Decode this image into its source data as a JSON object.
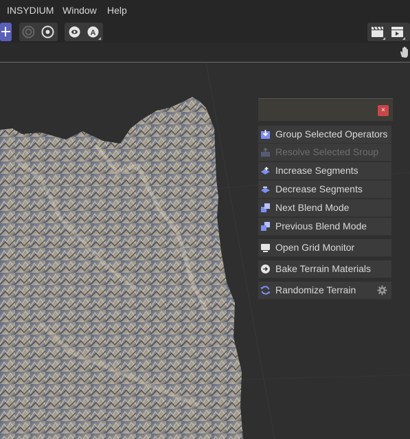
{
  "menu": {
    "items": [
      "INSYDIUM",
      "Window",
      "Help"
    ]
  },
  "panel": {
    "close_label": "×",
    "items": [
      {
        "label": "Group Selected Operators",
        "icon": "group-icon",
        "enabled": true
      },
      {
        "label": "Resolve Selected Sroup",
        "icon": "resolve-icon",
        "enabled": false
      },
      {
        "label": "Increase Segments",
        "icon": "increase-segments-icon",
        "enabled": true
      },
      {
        "label": "Decrease Segments",
        "icon": "decrease-segments-icon",
        "enabled": true
      },
      {
        "label": "Next Blend Mode",
        "icon": "next-blend-icon",
        "enabled": true
      },
      {
        "label": "Previous Blend Mode",
        "icon": "previous-blend-icon",
        "enabled": true
      },
      {
        "label": "Open Grid Monitor",
        "icon": "monitor-icon",
        "enabled": true
      },
      {
        "label": "Bake Terrain Materials",
        "icon": "bake-icon",
        "enabled": true
      },
      {
        "label": "Randomize Terrain",
        "icon": "randomize-icon",
        "enabled": true
      }
    ]
  },
  "colors": {
    "accent": "#5a5fb8",
    "close": "#c8474a",
    "panel_bg": "#3b3b3b",
    "icon_blue": "#7f8ff0"
  }
}
